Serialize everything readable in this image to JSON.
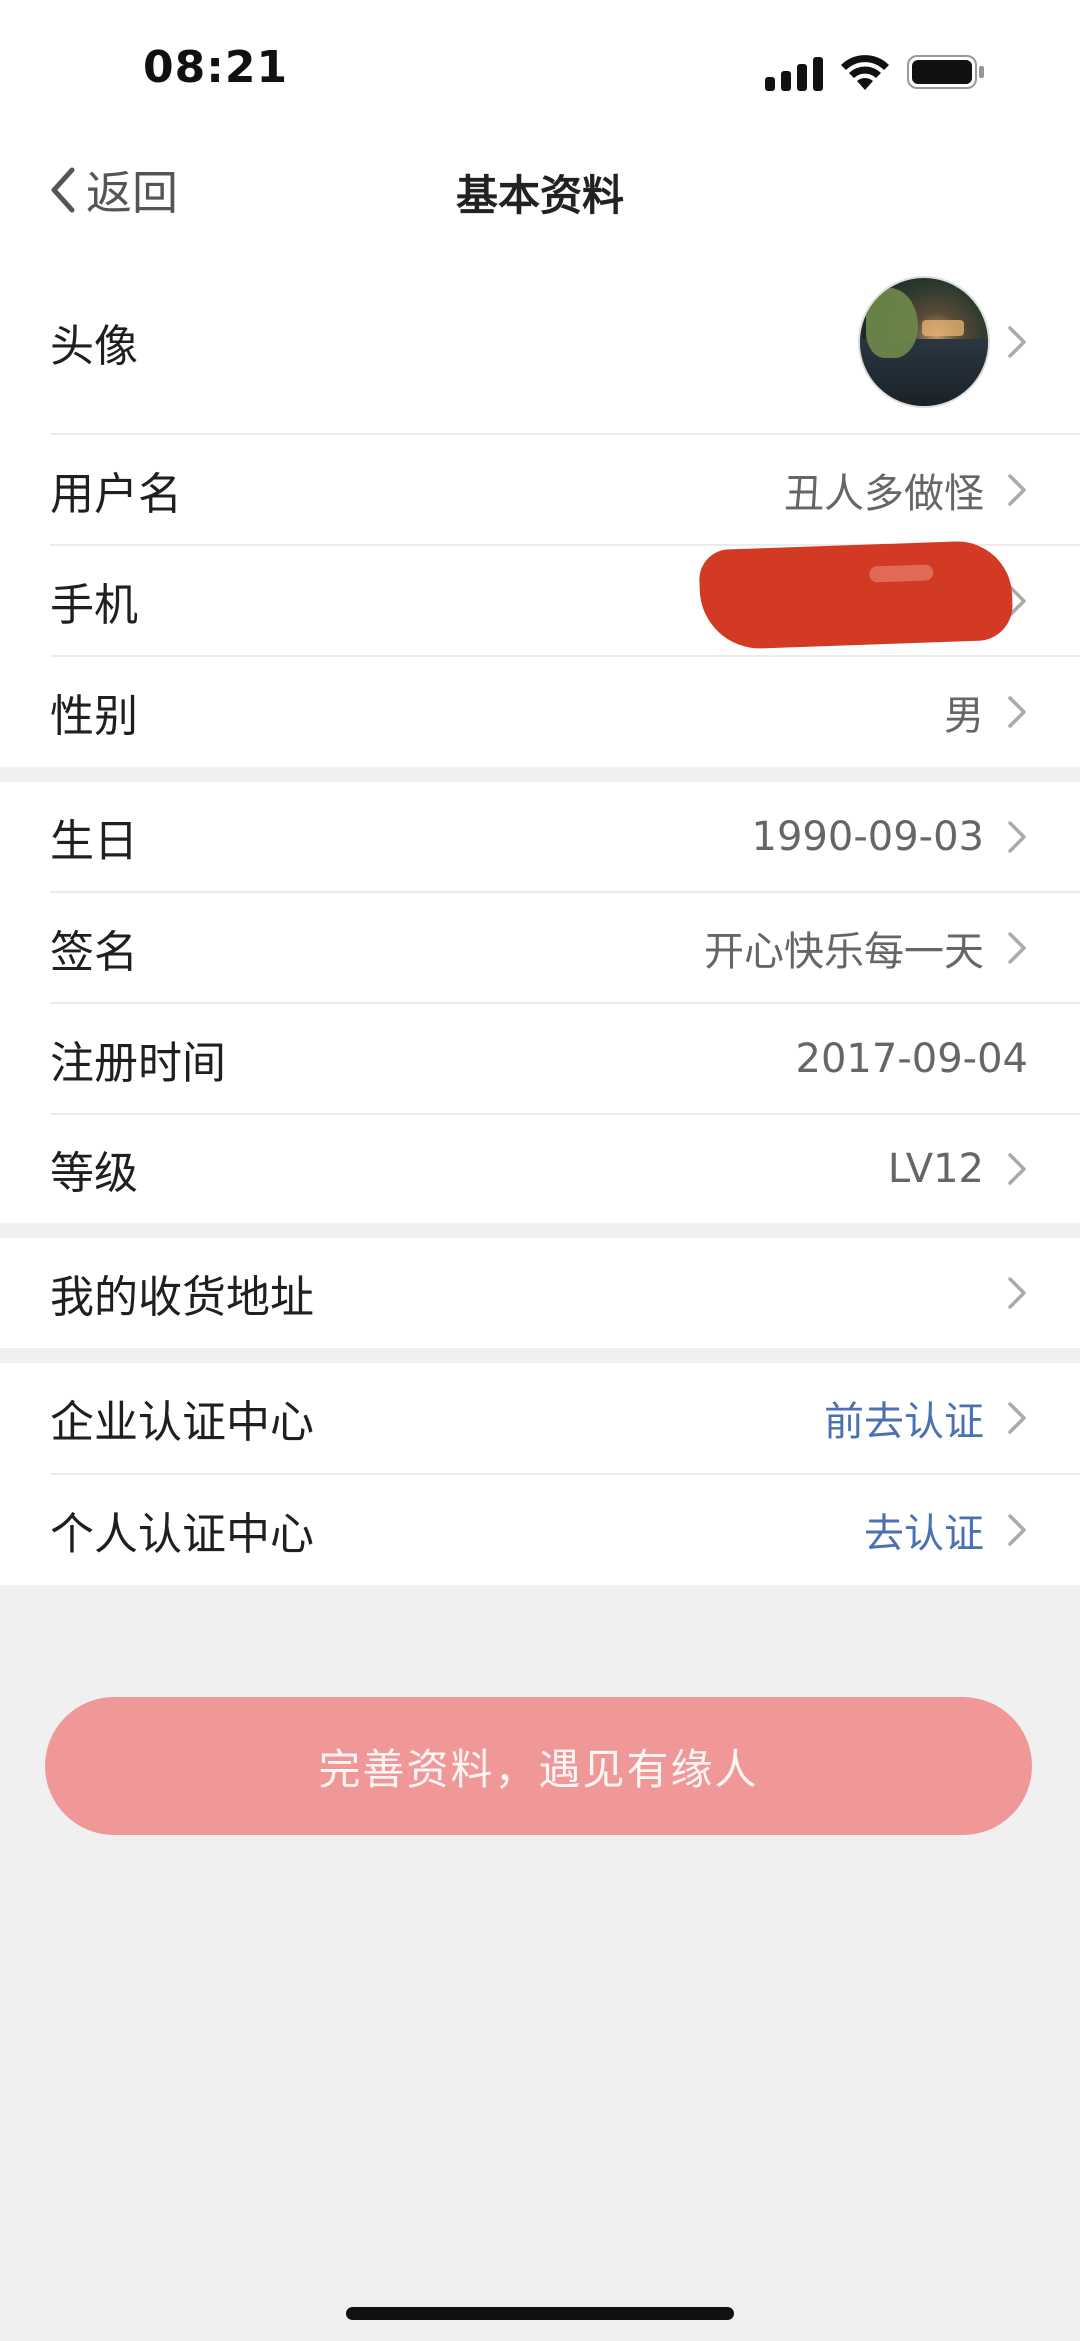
{
  "status_bar": {
    "time": "08:21"
  },
  "nav": {
    "back_label": "返回",
    "title": "基本资料"
  },
  "profile": {
    "avatar_label": "头像",
    "username_label": "用户名",
    "username_value": "丑人多做怪",
    "phone_label": "手机",
    "gender_label": "性别",
    "gender_value": "男"
  },
  "details": {
    "birthday_label": "生日",
    "birthday_value": "1990-09-03",
    "signature_label": "签名",
    "signature_value": "开心快乐每一天",
    "register_label": "注册时间",
    "register_value": "2017-09-04",
    "level_label": "等级",
    "level_value": "LV12"
  },
  "address": {
    "label": "我的收货地址"
  },
  "certification": {
    "enterprise_label": "企业认证中心",
    "enterprise_action": "前去认证",
    "personal_label": "个人认证中心",
    "personal_action": "去认证"
  },
  "submit_button": "完善资料，遇见有缘人",
  "colors": {
    "link": "#4a72b2",
    "button_bg": "#f09897",
    "redaction": "#d33a23",
    "page_bg": "#f0f0f0"
  }
}
